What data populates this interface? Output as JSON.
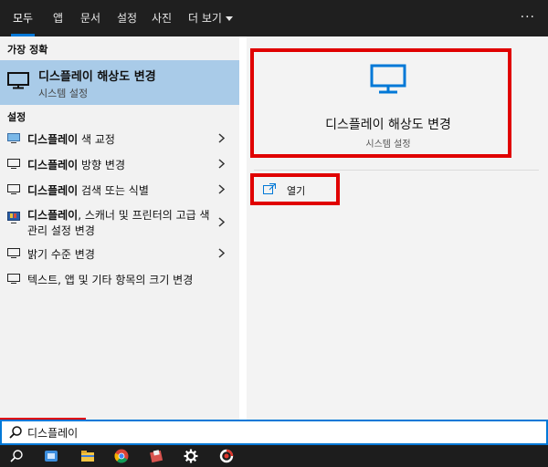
{
  "tabs": [
    {
      "label": "모두",
      "active": true
    },
    {
      "label": "앱"
    },
    {
      "label": "문서"
    },
    {
      "label": "설정"
    },
    {
      "label": "사진"
    },
    {
      "label": "더 보기"
    }
  ],
  "more_label": "···",
  "best_match": {
    "section": "가장 정확",
    "title": "디스플레이 해상도 변경",
    "subtitle": "시스템 설정",
    "icon": "monitor-icon"
  },
  "settings": {
    "section": "설정",
    "items": [
      {
        "bold": "디스플레이",
        "rest": " 색 교정",
        "icon": "color-calibration-icon"
      },
      {
        "bold": "디스플레이",
        "rest": " 방향 변경",
        "icon": "monitor-icon"
      },
      {
        "bold": "디스플레이",
        "rest": " 검색 또는 식별",
        "icon": "monitor-icon"
      },
      {
        "bold": "디스플레이",
        "rest": ", 스캐너 및 프린터의 고급 색 관리 설정 변경",
        "icon": "color-management-icon"
      },
      {
        "bold": "",
        "rest": "밝기 수준 변경",
        "icon": "monitor-icon"
      },
      {
        "bold": "",
        "rest": "텍스트, 앱 및 기타 항목의 크기 변경",
        "icon": "monitor-icon"
      }
    ]
  },
  "detail": {
    "title": "디스플레이 해상도 변경",
    "subtitle": "시스템 설정",
    "open_label": "열기"
  },
  "search": {
    "value": "디스플레이"
  },
  "taskbar": [
    "search-icon",
    "explorer-app-icon",
    "file-explorer-icon",
    "chrome-icon",
    "app-icon",
    "settings-gear-icon",
    "recorder-icon"
  ],
  "colors": {
    "accent": "#0078d7",
    "highlight": "#e00000",
    "selected_bg": "#a9cbe8",
    "topbar_bg": "#1f1f1f"
  }
}
